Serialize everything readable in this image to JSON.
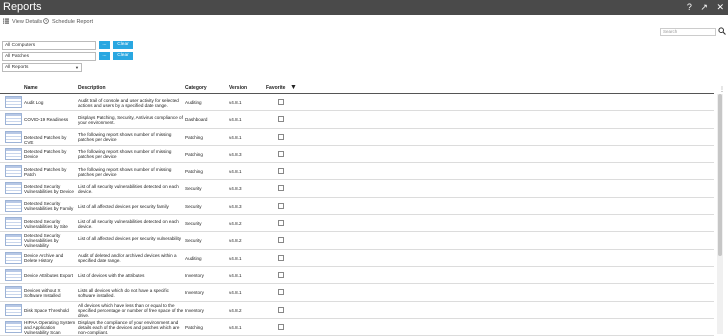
{
  "app": {
    "title": "Reports"
  },
  "titlebar_icons": [
    "?",
    "↗",
    "✕"
  ],
  "toolbar": {
    "view_details": "View Details",
    "schedule_report": "Schedule Report"
  },
  "search": {
    "placeholder": "Search"
  },
  "filters": {
    "computers": "All Computers",
    "patches": "All Patches",
    "dots_label": "...",
    "clear_label": "Clear",
    "report_type": "All Reports"
  },
  "table": {
    "columns": {
      "name": "Name",
      "description": "Description",
      "category": "Category",
      "version": "Version",
      "favorite": "Favorite"
    },
    "rows": [
      {
        "name": "Audit Log",
        "description": "Audit trail of console and user activity for selected actions and users by a specified date range.",
        "category": "Auditing",
        "version": "v4.8.1"
      },
      {
        "name": "COVID-19 Readiness",
        "description": "Displays Patching, Security, Antivirus compliance of your environment.",
        "category": "Dashboard",
        "version": "v4.8.1"
      },
      {
        "name": "Detected Patches by CVE",
        "description": "The following report shows number of missing patches per device",
        "category": "Patching",
        "version": "v4.8.1"
      },
      {
        "name": "Detected Patches by Device",
        "description": "The following report shows number of missing patches per device",
        "category": "Patching",
        "version": "v4.8.3"
      },
      {
        "name": "Detected Patches by Patch",
        "description": "The following report shows number of missing patches per device",
        "category": "Patching",
        "version": "v4.8.1"
      },
      {
        "name": "Detected Security Vulnerabilities by Device",
        "description": "List of all security vulnerabilities detected  on each device.",
        "category": "Security",
        "version": "v4.8.3"
      },
      {
        "name": "Detected Security Vulnerabilities by Family",
        "description": "List of all affected devices per security family",
        "category": "Security",
        "version": "v4.8.3"
      },
      {
        "name": "Detected Security Vulnerabilities by Site",
        "description": "List of all security vulnerabilities detected  on each device.",
        "category": "Security",
        "version": "v4.8.2"
      },
      {
        "name": "Detected Security Vulnerabilities by Vulnerability",
        "description": "List of all affected devices per security vulnerability",
        "category": "Security",
        "version": "v4.8.2"
      },
      {
        "name": "Device Archive and Delete History",
        "description": "Audit of deleted and/or archived devices within a specified date range.",
        "category": "Auditing",
        "version": "v4.8.1"
      },
      {
        "name": "Device Attributes Export",
        "description": "List of devices with the attributes",
        "category": "Inventory",
        "version": "v4.8.1"
      },
      {
        "name": "Devices without X Software Installed",
        "description": "Lists all devices which do not have a specific software installed.",
        "category": "Inventory",
        "version": "v4.8.1"
      },
      {
        "name": "Disk Space Threshold",
        "description": "All devices which have less than or equal to the specified percentage or number of free space of the drive.",
        "category": "Inventory",
        "version": "v4.8.2"
      },
      {
        "name": "HIPAA Operating System and Application Vulnerability Scan",
        "description": "Displays the compliance of your environment and details each of the devices and patches which are non-compliant.",
        "category": "Patching",
        "version": "v4.8.1"
      }
    ]
  }
}
